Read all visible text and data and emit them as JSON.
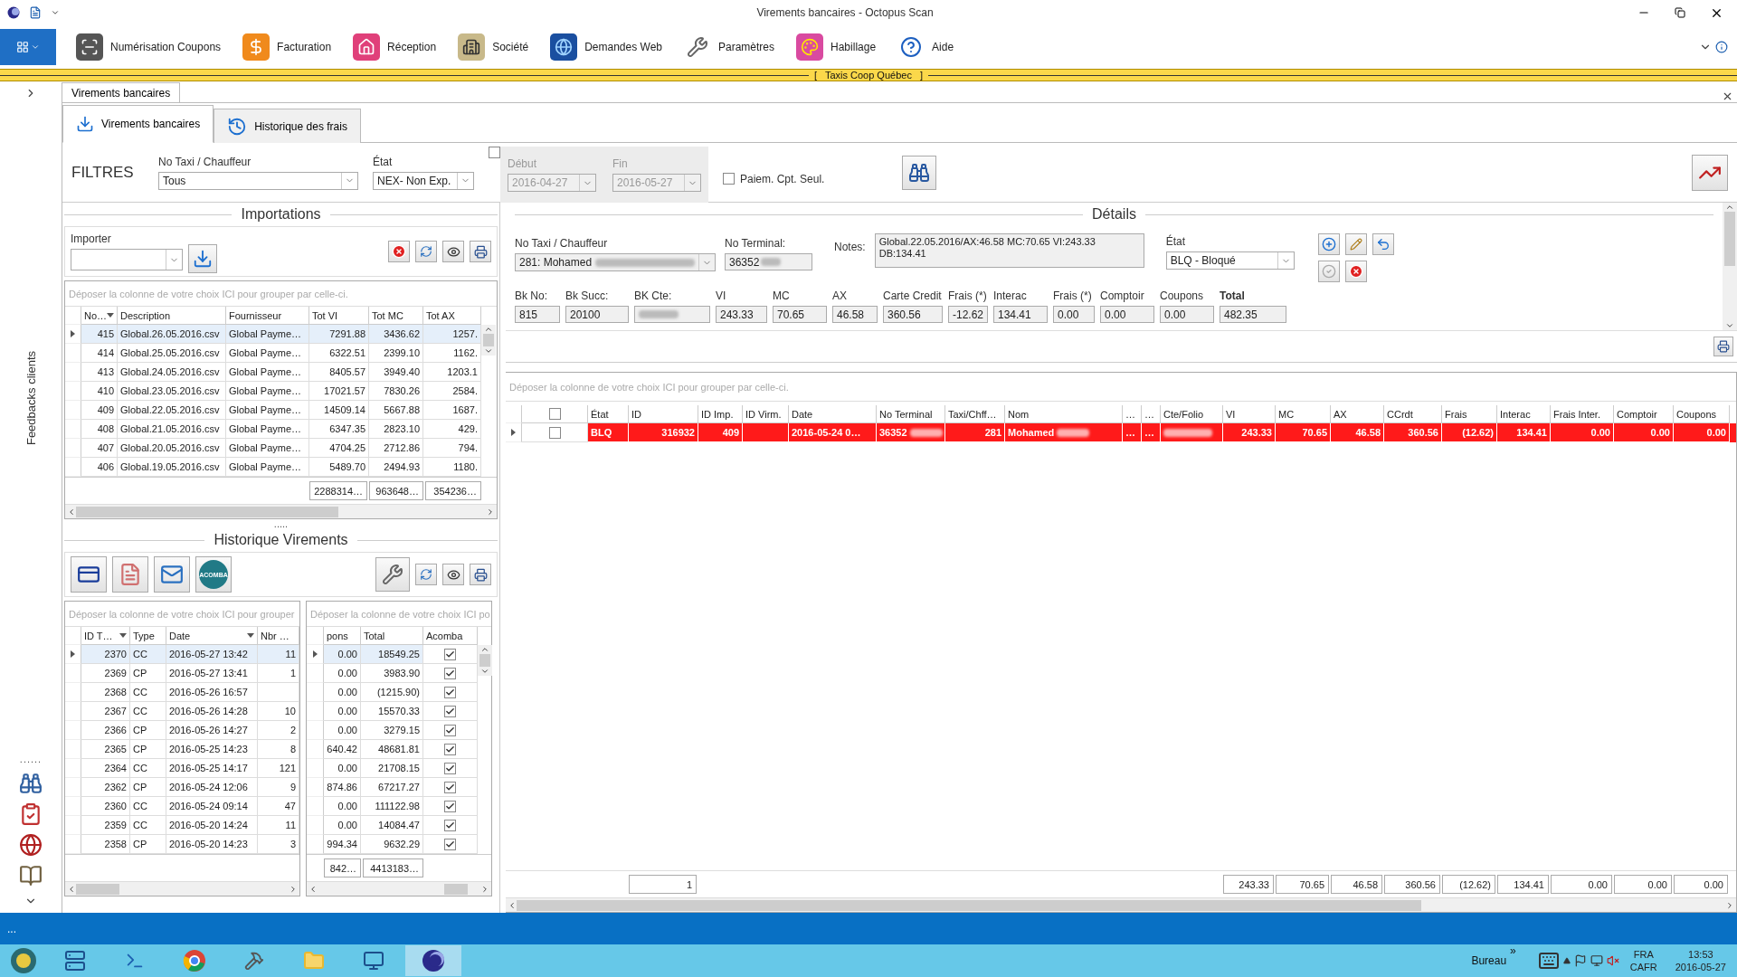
{
  "window": {
    "title": "Virements bancaires - Octopus Scan"
  },
  "ribbon": {
    "items": [
      {
        "label": "Numérisation Coupons"
      },
      {
        "label": "Facturation"
      },
      {
        "label": "Réception"
      },
      {
        "label": "Société"
      },
      {
        "label": "Demandes Web"
      },
      {
        "label": "Paramètres"
      },
      {
        "label": "Habillage"
      },
      {
        "label": "Aide"
      }
    ]
  },
  "banner": {
    "text": "[   Taxis Coop Québec   ]"
  },
  "side_rail": {
    "label": "Feedbacks clients",
    "grip": "......"
  },
  "document_tab": {
    "label": "Virements bancaires"
  },
  "tabs": [
    {
      "label": "Virements bancaires",
      "selected": true
    },
    {
      "label": "Historique des frais",
      "selected": false
    }
  ],
  "filters": {
    "title": "FILTRES",
    "taxi_label": "No Taxi / Chauffeur",
    "taxi_value": "Tous",
    "etat_label": "État",
    "etat_value": "NEX- Non Exp.",
    "date_checked": false,
    "debut_label": "Début",
    "debut_value": "2016-04-27",
    "fin_label": "Fin",
    "fin_value": "2016-05-27",
    "paiem_label": "Paiem. Cpt. Seul.",
    "paiem_checked": false
  },
  "importations": {
    "title": "Importations",
    "importer_label": "Importer",
    "group_hint": "Déposer la colonne de votre choix ICI pour grouper par celle-ci.",
    "columns": [
      {
        "label": "No…",
        "sorted": true
      },
      {
        "label": "Description",
        "sorted": false
      },
      {
        "label": "Fournisseur",
        "sorted": false
      },
      {
        "label": "Tot VI",
        "sorted": false
      },
      {
        "label": "Tot MC",
        "sorted": false
      },
      {
        "label": "Tot AX",
        "sorted": false
      }
    ],
    "rows": [
      {
        "selected": true,
        "cells": [
          "415",
          "Global.26.05.2016.csv",
          "Global Payme…",
          "7291.88",
          "3436.62",
          "1257."
        ]
      },
      {
        "selected": false,
        "cells": [
          "414",
          "Global.25.05.2016.csv",
          "Global Payme…",
          "6322.51",
          "2399.10",
          "1162."
        ]
      },
      {
        "selected": false,
        "cells": [
          "413",
          "Global.24.05.2016.csv",
          "Global Payme…",
          "8405.57",
          "3949.40",
          "1203.1"
        ]
      },
      {
        "selected": false,
        "cells": [
          "410",
          "Global.23.05.2016.csv",
          "Global Payme…",
          "17021.57",
          "7830.26",
          "2584."
        ]
      },
      {
        "selected": false,
        "cells": [
          "409",
          "Global.22.05.2016.csv",
          "Global Payme…",
          "14509.14",
          "5667.88",
          "1687."
        ]
      },
      {
        "selected": false,
        "cells": [
          "408",
          "Global.21.05.2016.csv",
          "Global Payme…",
          "6347.35",
          "2823.10",
          "429."
        ]
      },
      {
        "selected": false,
        "cells": [
          "407",
          "Global.20.05.2016.csv",
          "Global Payme…",
          "4704.25",
          "2712.86",
          "794."
        ]
      },
      {
        "selected": false,
        "cells": [
          "406",
          "Global.19.05.2016.csv",
          "Global Payme…",
          "5489.70",
          "2494.93",
          "1180."
        ]
      }
    ],
    "totals": [
      "2288314…",
      "963648…",
      "354236…"
    ]
  },
  "historique": {
    "title": "Historique Virements",
    "logo_text": "ACOMBA",
    "grip": ".....",
    "left_hint": "Déposer la colonne de votre choix ICI pour grouper",
    "left_columns": [
      {
        "label": "ID T…",
        "sorted": true
      },
      {
        "label": "Type",
        "sorted": false
      },
      {
        "label": "Date",
        "sorted": true
      },
      {
        "label": "Nbr …",
        "sorted": false
      }
    ],
    "left_rows": [
      {
        "selected": true,
        "cells": [
          "2370",
          "CC",
          "2016-05-27 13:42",
          "11"
        ]
      },
      {
        "selected": false,
        "cells": [
          "2369",
          "CP",
          "2016-05-27 13:41",
          "1"
        ]
      },
      {
        "selected": false,
        "cells": [
          "2368",
          "CC",
          "2016-05-26 16:57",
          null
        ]
      },
      {
        "selected": false,
        "cells": [
          "2367",
          "CC",
          "2016-05-26 14:28",
          "10"
        ]
      },
      {
        "selected": false,
        "cells": [
          "2366",
          "CP",
          "2016-05-26 14:27",
          "2"
        ]
      },
      {
        "selected": false,
        "cells": [
          "2365",
          "CP",
          "2016-05-25 14:23",
          "8"
        ]
      },
      {
        "selected": false,
        "cells": [
          "2364",
          "CC",
          "2016-05-25 14:17",
          "121"
        ]
      },
      {
        "selected": false,
        "cells": [
          "2362",
          "CP",
          "2016-05-24 12:06",
          "9"
        ]
      },
      {
        "selected": false,
        "cells": [
          "2360",
          "CC",
          "2016-05-24 09:14",
          "47"
        ]
      },
      {
        "selected": false,
        "cells": [
          "2359",
          "CC",
          "2016-05-20 14:24",
          "11"
        ]
      },
      {
        "selected": false,
        "cells": [
          "2358",
          "CP",
          "2016-05-20 14:23",
          "3"
        ]
      }
    ],
    "right_hint": "Déposer la colonne de votre choix ICI po",
    "right_columns": [
      {
        "label": "pons",
        "sorted": false
      },
      {
        "label": "Total",
        "sorted": false
      },
      {
        "label": "Acomba",
        "sorted": false
      }
    ],
    "right_rows": [
      {
        "selected": true,
        "acomba": true,
        "cells": [
          "0.00",
          "18549.25"
        ]
      },
      {
        "selected": false,
        "acomba": true,
        "cells": [
          "0.00",
          "3983.90"
        ]
      },
      {
        "selected": false,
        "acomba": true,
        "cells": [
          "0.00",
          "(1215.90)"
        ]
      },
      {
        "selected": false,
        "acomba": true,
        "cells": [
          "0.00",
          "15570.33"
        ]
      },
      {
        "selected": false,
        "acomba": true,
        "cells": [
          "0.00",
          "3279.15"
        ]
      },
      {
        "selected": false,
        "acomba": true,
        "cells": [
          "640.42",
          "48681.81"
        ]
      },
      {
        "selected": false,
        "acomba": true,
        "cells": [
          "0.00",
          "21708.15"
        ]
      },
      {
        "selected": false,
        "acomba": true,
        "cells": [
          "874.86",
          "67217.27"
        ]
      },
      {
        "selected": false,
        "acomba": true,
        "cells": [
          "0.00",
          "111122.98"
        ]
      },
      {
        "selected": false,
        "acomba": true,
        "cells": [
          "0.00",
          "14084.47"
        ]
      },
      {
        "selected": false,
        "acomba": true,
        "cells": [
          "994.34",
          "9632.29"
        ]
      }
    ],
    "right_totals": [
      "842…",
      "4413183…"
    ]
  },
  "details": {
    "title": "Détails",
    "taxi_label": "No Taxi / Chauffeur",
    "taxi_value": "281: Mohamed",
    "terminal_label": "No Terminal:",
    "terminal_value": "36352",
    "notes_label": "Notes:",
    "notes": "Global.22.05.2016/AX:46.58 MC:70.65 VI:243.33\nDB:134.41",
    "etat_label": "État",
    "etat_value": "BLQ - Bloqué",
    "fields": [
      {
        "kind": "plain",
        "label": "Bk No:",
        "value": "815"
      },
      {
        "kind": "plain",
        "label": "Bk Succ:",
        "value": "20100"
      },
      {
        "kind": "blurred",
        "label": "BK Cte:"
      },
      {
        "kind": "plain",
        "label": "VI",
        "value": "243.33"
      },
      {
        "kind": "plain",
        "label": "MC",
        "value": "70.65"
      },
      {
        "kind": "plain",
        "label": "AX",
        "value": "46.58"
      },
      {
        "kind": "plain",
        "label": "Carte Credit",
        "value": "360.56"
      },
      {
        "kind": "plain",
        "label": "Frais (*)",
        "value": "-12.62"
      },
      {
        "kind": "plain",
        "label": "Interac",
        "value": "134.41"
      },
      {
        "kind": "plain",
        "label": "Frais (*)",
        "value": "0.00"
      },
      {
        "kind": "plain",
        "label": "Comptoir",
        "value": "0.00"
      },
      {
        "kind": "plain",
        "label": "Coupons",
        "value": "0.00"
      },
      {
        "kind": "total",
        "label": "Total",
        "value": "482.35"
      }
    ]
  },
  "grid": {
    "group_hint": "Déposer la colonne de votre choix ICI pour grouper par celle-ci.",
    "header_checked": false,
    "columns": [
      "État",
      "ID",
      "ID Imp.",
      "ID Virm.",
      "Date",
      "No Terminal",
      "Taxi/Chff…",
      "Nom",
      "…",
      "…",
      "Cte/Folio",
      "VI",
      "MC",
      "AX",
      "CCrdt",
      "Frais",
      "Interac",
      "Frais Inter.",
      "Comptoir",
      "Coupons"
    ],
    "rows": [
      {
        "blocked": true,
        "checked": false,
        "cells": [
          {
            "text": "BLQ"
          },
          {
            "text": "316932"
          },
          {
            "text": "409"
          },
          null,
          {
            "text": "2016-05-24 0…"
          },
          {
            "text": "36352",
            "blurred": true
          },
          {
            "text": "281"
          },
          {
            "text": "Mohamed",
            "blurred": true
          },
          {
            "text": "…"
          },
          {
            "text": "…"
          },
          {
            "blurred": true
          },
          {
            "text": "243.33"
          },
          {
            "text": "70.65"
          },
          {
            "text": "46.58"
          },
          {
            "text": "360.56"
          },
          {
            "text": "(12.62)"
          },
          {
            "text": "134.41"
          },
          {
            "text": "0.00"
          },
          {
            "text": "0.00"
          },
          {
            "text": "0.00"
          }
        ]
      }
    ],
    "footer_count": "1",
    "footer_totals": [
      "243.33",
      "70.65",
      "46.58",
      "360.56",
      "(12.62)",
      "134.41",
      "0.00",
      "0.00",
      "0.00"
    ]
  },
  "status_bar": {
    "text": "..."
  },
  "taskbar": {
    "toolbar_label": "Bureau",
    "overflow": "»",
    "language": "FRA",
    "layout": "CAFR",
    "time": "13:53",
    "date": "2016-05-27"
  }
}
